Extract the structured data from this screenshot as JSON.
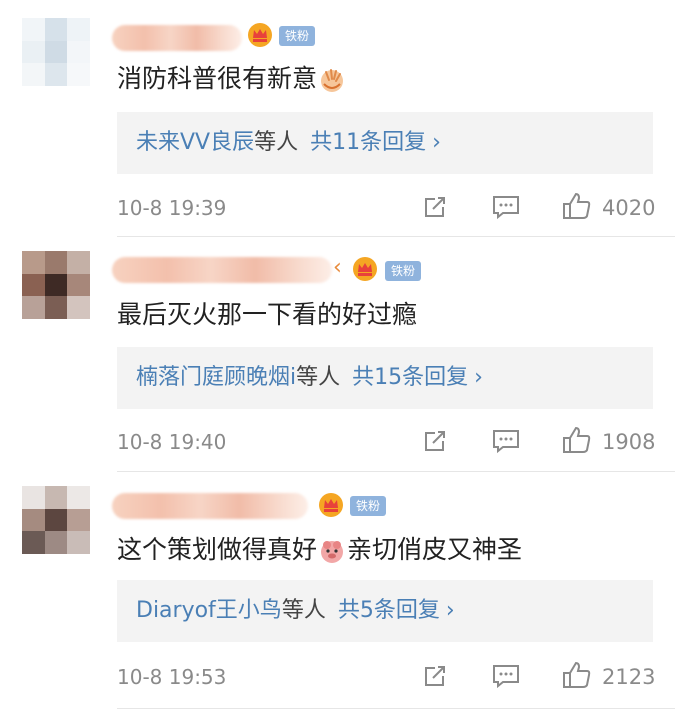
{
  "comments": [
    {
      "text_before": "消防科普很有新意",
      "emoji": "clap-hands-emoji",
      "text_after": "",
      "fan_badge": "铁粉",
      "reply_names": "未来VV良辰",
      "reply_others": "等人",
      "reply_count": "共11条回复",
      "reply_chevron": "›",
      "date": "10-8 19:39",
      "likes": "4020"
    },
    {
      "text_before": "最后灭火那一下看的好过瘾",
      "emoji": "",
      "text_after": "",
      "fan_badge": "铁粉",
      "reply_names": "楠落门庭顾晚烟i",
      "reply_others": "等人",
      "reply_count": "共15条回复",
      "reply_chevron": "›",
      "date": "10-8 19:40",
      "likes": "1908"
    },
    {
      "text_before": "这个策划做得真好",
      "emoji": "cute-pig-emoji",
      "text_after": "亲切俏皮又神圣",
      "fan_badge": "铁粉",
      "reply_names": "Diaryof王小鸟",
      "reply_others": "等人",
      "reply_count": "共5条回复",
      "reply_chevron": "›",
      "date": "10-8 19:53",
      "likes": "2123"
    }
  ],
  "colors": {
    "link": "#4a7fb5",
    "meta": "#8a8a8a",
    "fan_badge_bg": "#8fb3dd",
    "reply_bg": "#f3f3f3"
  }
}
